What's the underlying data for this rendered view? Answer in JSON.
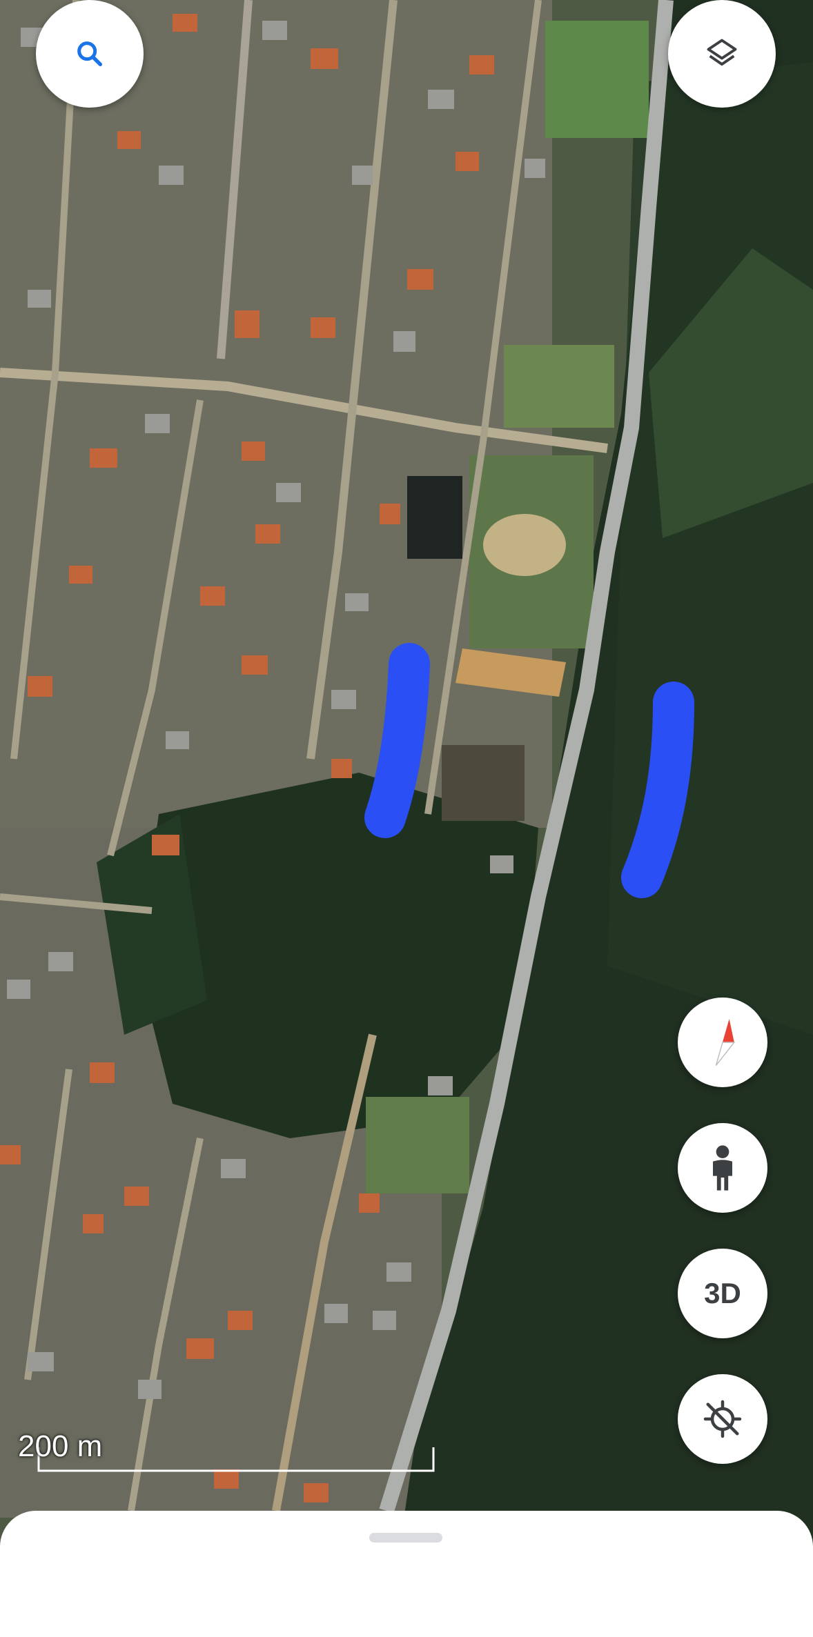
{
  "map": {
    "type": "satellite",
    "scale_label": "200 m",
    "highlight_color": "#2a4ff5"
  },
  "controls": {
    "search": {
      "icon": "search-icon",
      "color": "#1a73e8"
    },
    "layers": {
      "icon": "layers-icon"
    },
    "compass": {
      "icon": "compass-icon",
      "accent": "#ea4335"
    },
    "street_view": {
      "icon": "pegman-icon"
    },
    "view_3d": {
      "label": "3D"
    },
    "location": {
      "icon": "location-off-icon"
    }
  },
  "bottom_sheet": {
    "handle": true
  }
}
